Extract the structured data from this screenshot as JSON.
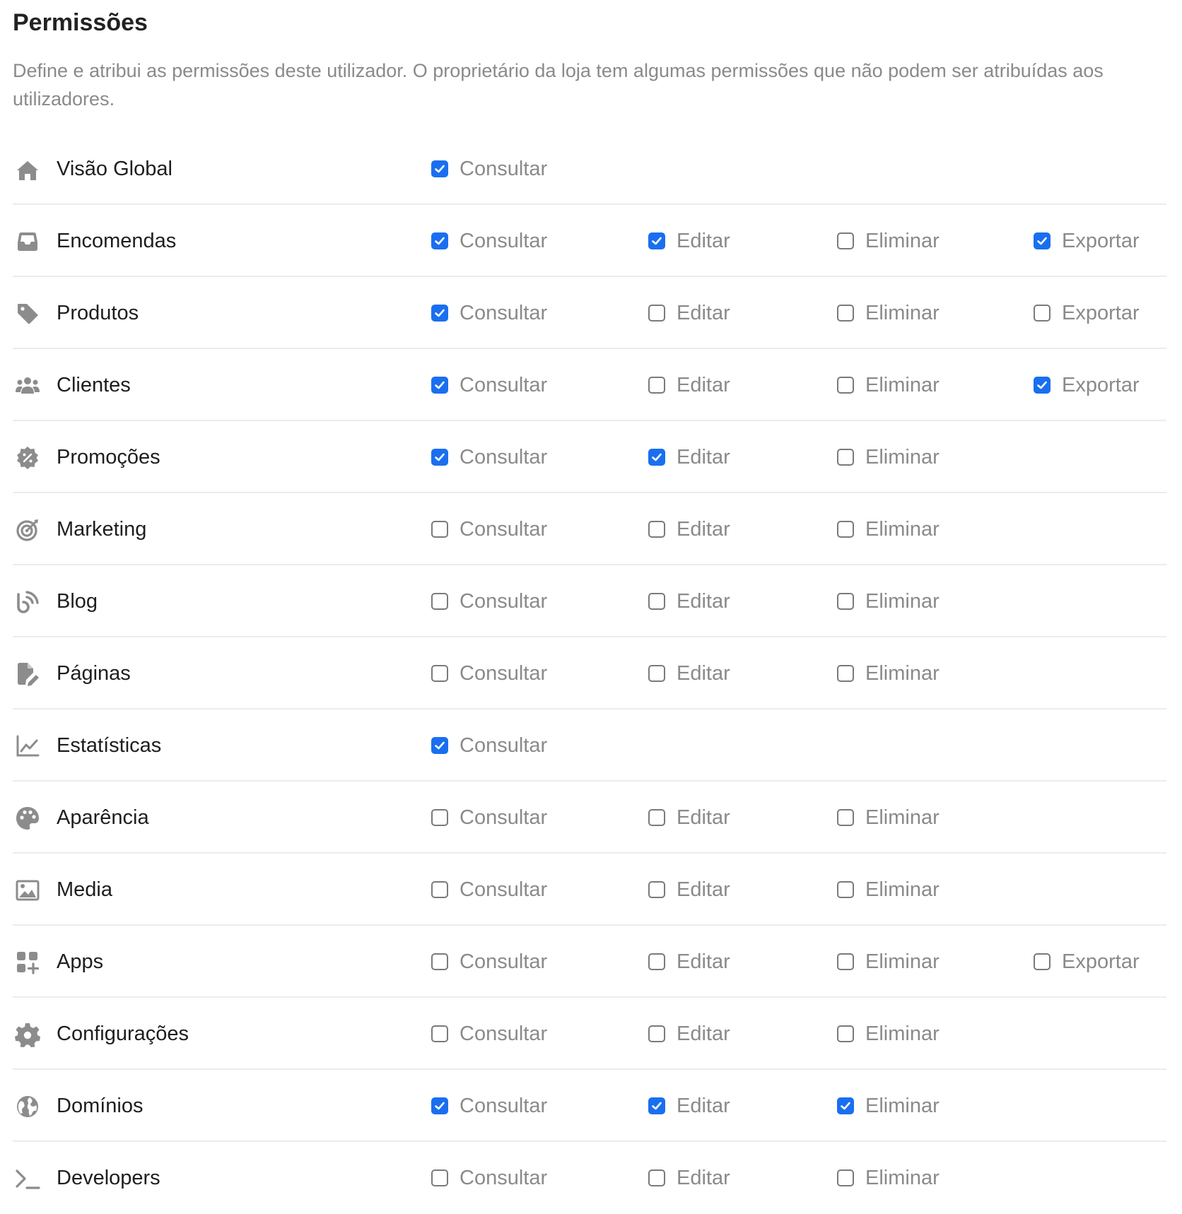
{
  "header": {
    "title": "Permissões",
    "description": "Define e atribui as permissões deste utilizador. O proprietário da loja tem algumas permissões que não podem ser atribuídas aos utilizadores."
  },
  "colors": {
    "accent": "#1a6ff0",
    "icon": "#8c8c8c",
    "muted_text": "#8a8a8a"
  },
  "permission_labels": [
    "Consultar",
    "Editar",
    "Eliminar",
    "Exportar"
  ],
  "rows": [
    {
      "label": "Visão Global",
      "icon": "home-icon",
      "perms": {
        "Consultar": true
      }
    },
    {
      "label": "Encomendas",
      "icon": "inbox-tray-icon",
      "perms": {
        "Consultar": true,
        "Editar": true,
        "Eliminar": false,
        "Exportar": true
      }
    },
    {
      "label": "Produtos",
      "icon": "tag-icon",
      "perms": {
        "Consultar": true,
        "Editar": false,
        "Eliminar": false,
        "Exportar": false
      }
    },
    {
      "label": "Clientes",
      "icon": "users-icon",
      "perms": {
        "Consultar": true,
        "Editar": false,
        "Eliminar": false,
        "Exportar": true
      }
    },
    {
      "label": "Promoções",
      "icon": "discount-badge-icon",
      "perms": {
        "Consultar": true,
        "Editar": true,
        "Eliminar": false
      }
    },
    {
      "label": "Marketing",
      "icon": "target-icon",
      "perms": {
        "Consultar": false,
        "Editar": false,
        "Eliminar": false
      }
    },
    {
      "label": "Blog",
      "icon": "blog-rss-icon",
      "perms": {
        "Consultar": false,
        "Editar": false,
        "Eliminar": false
      }
    },
    {
      "label": "Páginas",
      "icon": "file-edit-icon",
      "perms": {
        "Consultar": false,
        "Editar": false,
        "Eliminar": false
      }
    },
    {
      "label": "Estatísticas",
      "icon": "line-chart-icon",
      "perms": {
        "Consultar": true
      }
    },
    {
      "label": "Aparência",
      "icon": "palette-icon",
      "perms": {
        "Consultar": false,
        "Editar": false,
        "Eliminar": false
      }
    },
    {
      "label": "Media",
      "icon": "image-icon",
      "perms": {
        "Consultar": false,
        "Editar": false,
        "Eliminar": false
      }
    },
    {
      "label": "Apps",
      "icon": "apps-grid-plus-icon",
      "perms": {
        "Consultar": false,
        "Editar": false,
        "Eliminar": false,
        "Exportar": false
      }
    },
    {
      "label": "Configurações",
      "icon": "gear-icon",
      "perms": {
        "Consultar": false,
        "Editar": false,
        "Eliminar": false
      }
    },
    {
      "label": "Domínios",
      "icon": "globe-icon",
      "perms": {
        "Consultar": true,
        "Editar": true,
        "Eliminar": true
      }
    },
    {
      "label": "Developers",
      "icon": "terminal-icon",
      "perms": {
        "Consultar": false,
        "Editar": false,
        "Eliminar": false
      }
    }
  ]
}
